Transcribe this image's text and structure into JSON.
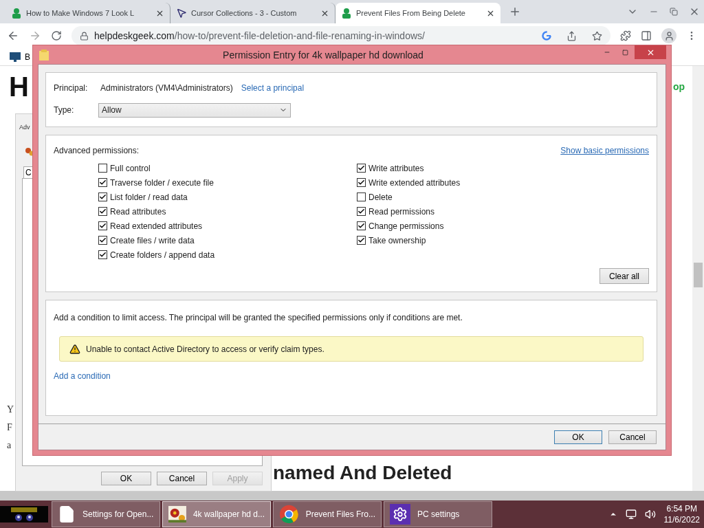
{
  "browser": {
    "tabs": [
      {
        "title": "How to Make Windows 7 Look L",
        "kind": "person",
        "selected": false
      },
      {
        "title": "Cursor Collections - 3 - Custom",
        "kind": "cursor",
        "selected": false
      },
      {
        "title": "Prevent Files From Being Delete",
        "kind": "person",
        "selected": true
      }
    ],
    "url": {
      "host": "helpdeskgeek.com",
      "path": "/how-to/prevent-file-deletion-and-file-renaming-in-windows/"
    },
    "bookmark": "B",
    "page": {
      "logo": "H",
      "top_link": "op",
      "letters": [
        "Y",
        "F",
        "a"
      ],
      "heading": "named And Deleted"
    }
  },
  "background_dialog": {
    "label": "Adv",
    "tab": "C",
    "buttons": [
      {
        "label": "OK",
        "disabled": false
      },
      {
        "label": "Cancel",
        "disabled": false
      },
      {
        "label": "Apply",
        "disabled": true
      }
    ]
  },
  "dialog": {
    "title": "Permission Entry for 4k wallpaper hd download",
    "principal_label": "Principal:",
    "principal": "Administrators (VM4\\Administrators)",
    "select_link": "Select a principal",
    "type_label": "Type:",
    "type_value": "Allow",
    "permissions_heading": "Advanced permissions:",
    "basic_link": "Show basic permissions",
    "permission_columns": [
      [
        {
          "label": "Full control",
          "checked": false
        },
        {
          "label": "Traverse folder / execute file",
          "checked": true
        },
        {
          "label": "List folder / read data",
          "checked": true
        },
        {
          "label": "Read attributes",
          "checked": true
        },
        {
          "label": "Read extended attributes",
          "checked": true
        },
        {
          "label": "Create files / write data",
          "checked": true
        },
        {
          "label": "Create folders / append data",
          "checked": true
        }
      ],
      [
        {
          "label": "Write attributes",
          "checked": true
        },
        {
          "label": "Write extended attributes",
          "checked": true
        },
        {
          "label": "Delete",
          "checked": false
        },
        {
          "label": "Read permissions",
          "checked": true
        },
        {
          "label": "Change permissions",
          "checked": true
        },
        {
          "label": "Take ownership",
          "checked": true
        }
      ]
    ],
    "clear_button": "Clear all",
    "condition_text": "Add a condition to limit access. The principal will be granted the specified permissions only if conditions are met.",
    "warning": "Unable to contact Active Directory to access or verify claim types.",
    "add_condition": "Add a condition",
    "buttons": [
      {
        "label": "OK",
        "default": true
      },
      {
        "label": "Cancel",
        "default": false
      }
    ]
  },
  "taskbar": {
    "items": [
      {
        "label": "Settings for Open...",
        "kind": "document",
        "selected": false
      },
      {
        "label": "4k wallpaper hd d...",
        "selected": true
      },
      {
        "label": "Prevent Files Fro...",
        "kind": "chrome",
        "selected": false
      },
      {
        "label": "PC settings",
        "kind": "settings",
        "selected": false
      }
    ],
    "time": "6:54 PM",
    "date": "11/6/2022"
  }
}
